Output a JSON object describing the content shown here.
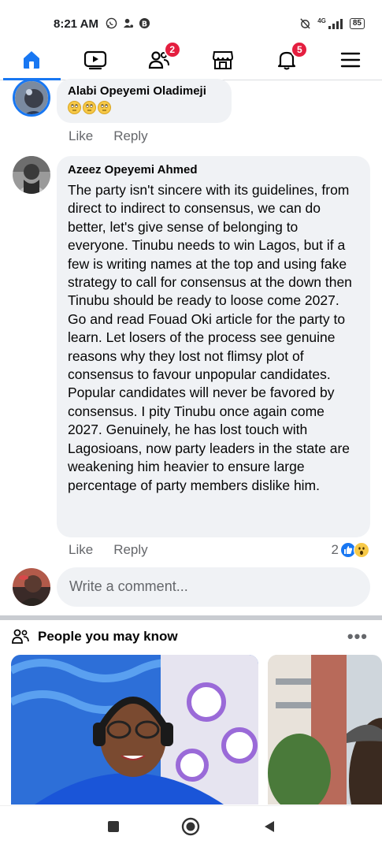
{
  "status_bar": {
    "time": "8:21 AM",
    "network_label": "4G",
    "battery": "85"
  },
  "nav": {
    "items": [
      {
        "name": "home-icon",
        "badge": ""
      },
      {
        "name": "video-icon",
        "badge": ""
      },
      {
        "name": "friends-icon",
        "badge": "2"
      },
      {
        "name": "marketplace-icon",
        "badge": ""
      },
      {
        "name": "notifications-icon",
        "badge": "5"
      },
      {
        "name": "menu-icon",
        "badge": ""
      }
    ],
    "accent": "#1877f2",
    "badge_color": "#e41e3f"
  },
  "comments": [
    {
      "author": "Alabi Opeyemi Oladimeji",
      "emojis": [
        "rolling-eyes-emoji",
        "rolling-eyes-emoji",
        "rolling-eyes-emoji"
      ],
      "like_label": "Like",
      "reply_label": "Reply"
    },
    {
      "author": "Azeez Opeyemi Ahmed",
      "text": "The party isn't sincere with its guidelines, from direct to indirect to consensus, we can do better, let's give sense of belonging to everyone. Tinubu needs to win Lagos, but if a few is writing names at the top and using fake strategy to call for consensus at the down then Tinubu should be ready to loose come 2027. Go and read Fouad Oki article for the party to learn. Let losers of the process see genuine reasons why they lost not flimsy plot of consensus to favour unpopular candidates. Popular candidates will never be favored by consensus. I pity Tinubu once again come 2027. Genuinely, he has lost touch with Lagosioans, now party leaders in the state are weakening him heavier to ensure large percentage of party members dislike him.",
      "like_label": "Like",
      "reply_label": "Reply",
      "reaction_count": "2",
      "reactions": [
        "like-reaction-icon",
        "wow-reaction-icon"
      ]
    }
  ],
  "write_comment": {
    "placeholder": "Write a comment..."
  },
  "people_you_may_know": {
    "title": "People you may know",
    "more_label": "•••"
  }
}
